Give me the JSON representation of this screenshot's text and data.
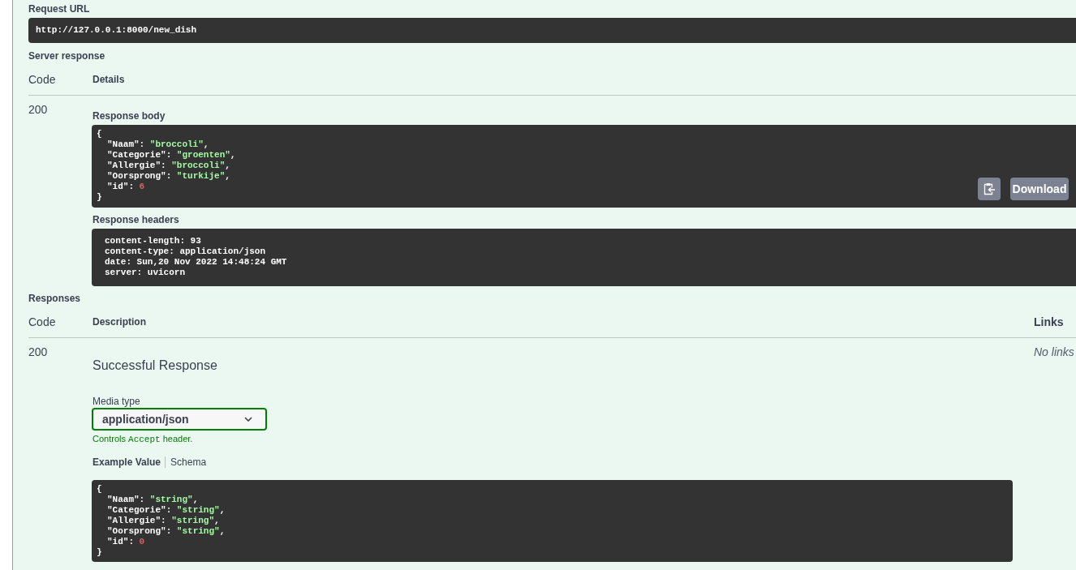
{
  "request_url": {
    "label": "Request URL",
    "url": "http://127.0.0.1:8000/new_dish"
  },
  "server_response": {
    "title": "Server response",
    "columns": [
      "Code",
      "Details"
    ],
    "code": "200",
    "response_body": {
      "label": "Response body",
      "open": "{",
      "entries": [
        [
          {
            "kind": "key",
            "text": "\"Naam\""
          },
          {
            "kind": "punct",
            "text": ": "
          },
          {
            "kind": "string",
            "text": "\"broccoli\""
          },
          {
            "kind": "punct",
            "text": ","
          }
        ],
        [
          {
            "kind": "key",
            "text": "\"Categorie\""
          },
          {
            "kind": "punct",
            "text": ": "
          },
          {
            "kind": "string",
            "text": "\"groenten\""
          },
          {
            "kind": "punct",
            "text": ","
          }
        ],
        [
          {
            "kind": "key",
            "text": "\"Allergie\""
          },
          {
            "kind": "punct",
            "text": ": "
          },
          {
            "kind": "string",
            "text": "\"broccoli\""
          },
          {
            "kind": "punct",
            "text": ","
          }
        ],
        [
          {
            "kind": "key",
            "text": "\"Oorsprong\""
          },
          {
            "kind": "punct",
            "text": ": "
          },
          {
            "kind": "string",
            "text": "\"turkije\""
          },
          {
            "kind": "punct",
            "text": ","
          }
        ],
        [
          {
            "kind": "key",
            "text": "\"id\""
          },
          {
            "kind": "punct",
            "text": ": "
          },
          {
            "kind": "number",
            "text": "6"
          }
        ]
      ],
      "close": "}",
      "download_label": "Download"
    },
    "response_headers": {
      "label": "Response headers",
      "lines": [
        "content-length: 93",
        "content-type: application/json",
        "date: Sun,20 Nov 2022 14:48:24 GMT",
        "server: uvicorn"
      ]
    }
  },
  "responses": {
    "title": "Responses",
    "columns": [
      "Code",
      "Description",
      "Links"
    ],
    "rows": [
      {
        "code": "200",
        "description": "Successful Response",
        "media_type_label": "Media type",
        "media_type": "application/json",
        "hint": [
          {
            "kind": "text",
            "text": "Controls"
          },
          {
            "kind": "code",
            "text": "Accept"
          },
          {
            "kind": "text",
            "text": "header."
          }
        ],
        "tabs": [
          {
            "label": "Example Value",
            "selected": true
          },
          {
            "label": "Schema",
            "selected": false
          }
        ],
        "example": {
          "open": "{",
          "entries": [
            [
              {
                "kind": "key",
                "text": "\"Naam\""
              },
              {
                "kind": "punct",
                "text": ": "
              },
              {
                "kind": "string",
                "text": "\"string\""
              },
              {
                "kind": "punct",
                "text": ","
              }
            ],
            [
              {
                "kind": "key",
                "text": "\"Categorie\""
              },
              {
                "kind": "punct",
                "text": ": "
              },
              {
                "kind": "string",
                "text": "\"string\""
              },
              {
                "kind": "punct",
                "text": ","
              }
            ],
            [
              {
                "kind": "key",
                "text": "\"Allergie\""
              },
              {
                "kind": "punct",
                "text": ": "
              },
              {
                "kind": "string",
                "text": "\"string\""
              },
              {
                "kind": "punct",
                "text": ","
              }
            ],
            [
              {
                "kind": "key",
                "text": "\"Oorsprong\""
              },
              {
                "kind": "punct",
                "text": ": "
              },
              {
                "kind": "string",
                "text": "\"string\""
              },
              {
                "kind": "punct",
                "text": ","
              }
            ],
            [
              {
                "kind": "key",
                "text": "\"id\""
              },
              {
                "kind": "punct",
                "text": ": "
              },
              {
                "kind": "number",
                "text": "0"
              }
            ]
          ],
          "close": "}"
        },
        "links": "No links"
      }
    ]
  }
}
